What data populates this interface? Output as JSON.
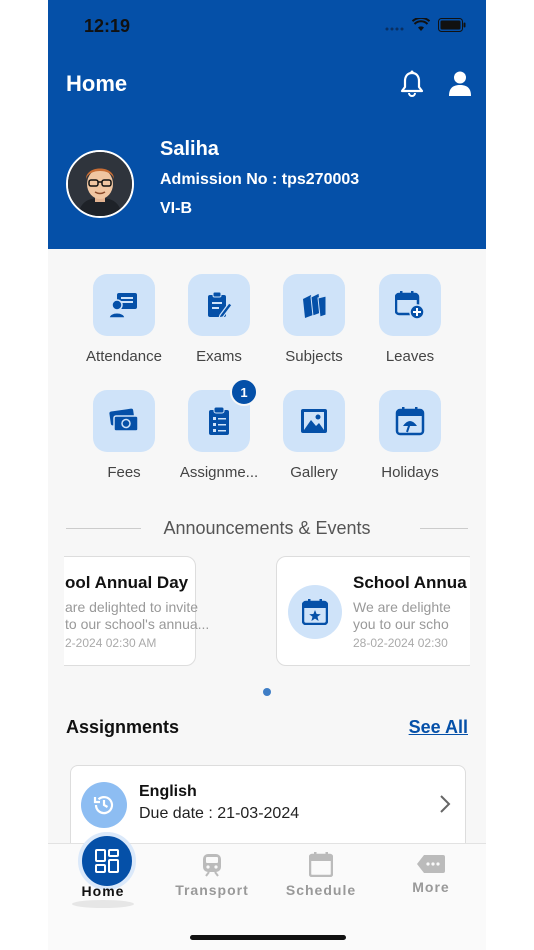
{
  "status_bar": {
    "time": "12:19"
  },
  "header": {
    "title": "Home",
    "student": {
      "name": "Saliha",
      "admission": "Admission No : tps270003",
      "class": "VI-B"
    }
  },
  "menu": [
    {
      "label": "Attendance",
      "icon": "attendance-icon"
    },
    {
      "label": "Exams",
      "icon": "exams-icon"
    },
    {
      "label": "Subjects",
      "icon": "subjects-icon"
    },
    {
      "label": "Leaves",
      "icon": "leaves-icon"
    },
    {
      "label": "Fees",
      "icon": "fees-icon"
    },
    {
      "label": "Assignme...",
      "icon": "assignments-icon",
      "badge": "1"
    },
    {
      "label": "Gallery",
      "icon": "gallery-icon"
    },
    {
      "label": "Holidays",
      "icon": "holidays-icon"
    }
  ],
  "announcements": {
    "title": "Announcements & Events",
    "cards": [
      {
        "title": "ool Annual Day",
        "desc1": "are delighted to invite",
        "desc2": "to our school's annua...",
        "date": "2-2024 02:30 AM"
      },
      {
        "title": "School Annua",
        "desc1": "We are delighte",
        "desc2": "you to our scho",
        "date": "28-02-2024 02:30"
      }
    ]
  },
  "assignments": {
    "title": "Assignments",
    "see_all": "See All",
    "items": [
      {
        "subject": "English",
        "due": "Due date : 21-03-2024"
      }
    ]
  },
  "tabbar": {
    "items": [
      {
        "label": "Home",
        "active": true
      },
      {
        "label": "Transport"
      },
      {
        "label": "Schedule"
      },
      {
        "label": "More"
      }
    ]
  },
  "colors": {
    "primary": "#0550a8",
    "icon_bg": "#cfe3f9"
  }
}
